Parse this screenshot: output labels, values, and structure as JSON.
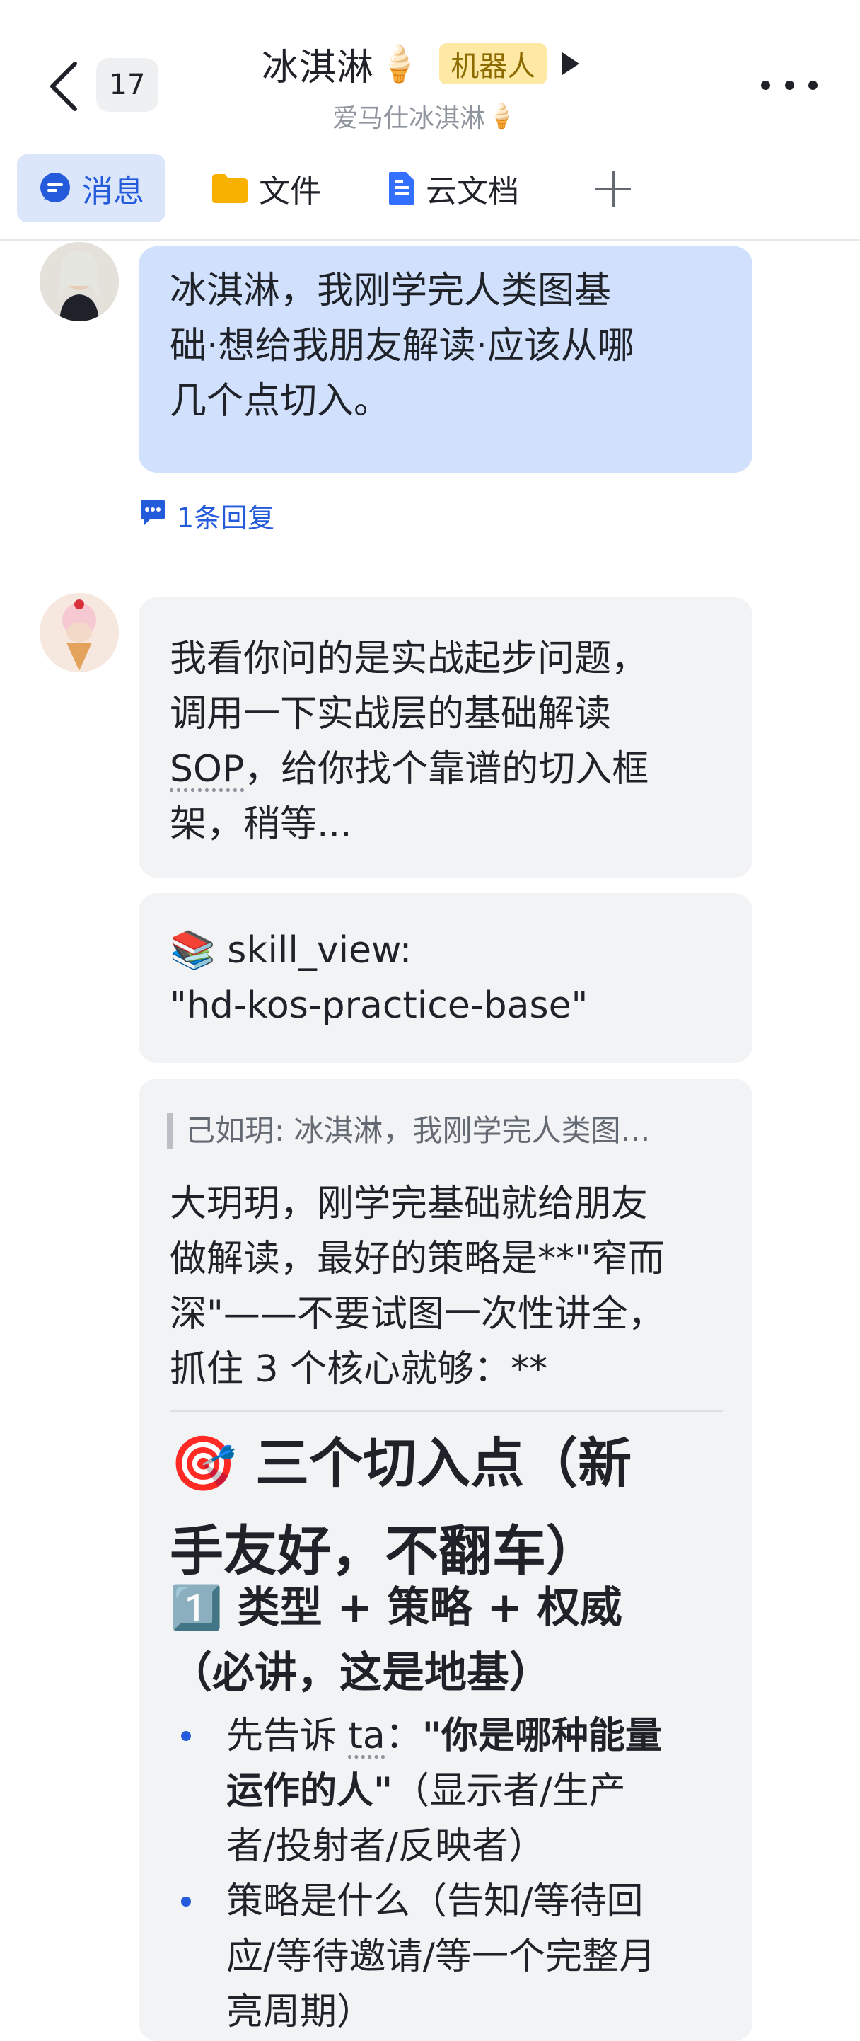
{
  "header": {
    "unread_count": "17",
    "title": "冰淇淋",
    "title_emoji": "🍦",
    "bot_tag": "机器人",
    "subtitle": "爱马仕冰淇淋",
    "subtitle_emoji": "🍦",
    "icons": {
      "back": "chevron-left-icon",
      "more": "more-dots-icon",
      "play": "play-icon"
    }
  },
  "tabs": [
    {
      "label": "消息",
      "icon": "chat-bubble-icon",
      "active": true
    },
    {
      "label": "文件",
      "icon": "folder-icon",
      "active": false
    },
    {
      "label": "云文档",
      "icon": "document-icon",
      "active": false
    }
  ],
  "messages": {
    "user_message": {
      "lines": [
        "冰淇淋，我刚学完人类图基",
        "础·想给我朋友解读·应该从哪",
        "几个点切入。"
      ],
      "reply_count_label": "1条回复"
    },
    "bot_intro": {
      "line1": "我看你问的是实战起步问题，",
      "line2": "调用一下实战层的基础解读",
      "line3_prefix": "SOP",
      "line3_suffix": "，给你找个靠谱的切入框",
      "line4": "架，稍等..."
    },
    "bot_skill": {
      "emoji": "📚",
      "line1": "skill_view:",
      "line2": "\"hd-kos-practice-base\""
    },
    "bot_answer": {
      "quote": "己如玥: 冰淇淋，我刚学完人类图…",
      "paragraph_lines": [
        "大玥玥，刚学完基础就给朋友",
        "做解读，最好的策略是**\"窄而",
        "深\"——不要试图一次性讲全，",
        "抓住 3 个核心就够：**"
      ],
      "heading1_emoji": "🎯",
      "heading1_line1": "三个切入点（新",
      "heading1_line2": "手友好，不翻车）",
      "heading2_emoji": "1️⃣",
      "heading2_line1": "类型 + 策略 + 权威",
      "heading2_line2": "（必讲，这是地基）",
      "bullet1": {
        "prefix": "先告诉 ",
        "ta": "ta",
        "colon": "：",
        "bold1": "\"你是哪种能量",
        "bold2": "运作的人\"",
        "rest1": "（显示者/生产",
        "rest2": "者/投射者/反映者）"
      },
      "bullet2": {
        "line1": "策略是什么（告知/等待回",
        "line2": "应/等待邀请/等一个完整月",
        "line3": "亮周期）"
      }
    }
  },
  "colors": {
    "accent": "#245bdb",
    "user_bubble": "#d1e0fd",
    "bot_bubble": "#f2f3f5",
    "bot_tag_bg": "#fde9a4"
  }
}
